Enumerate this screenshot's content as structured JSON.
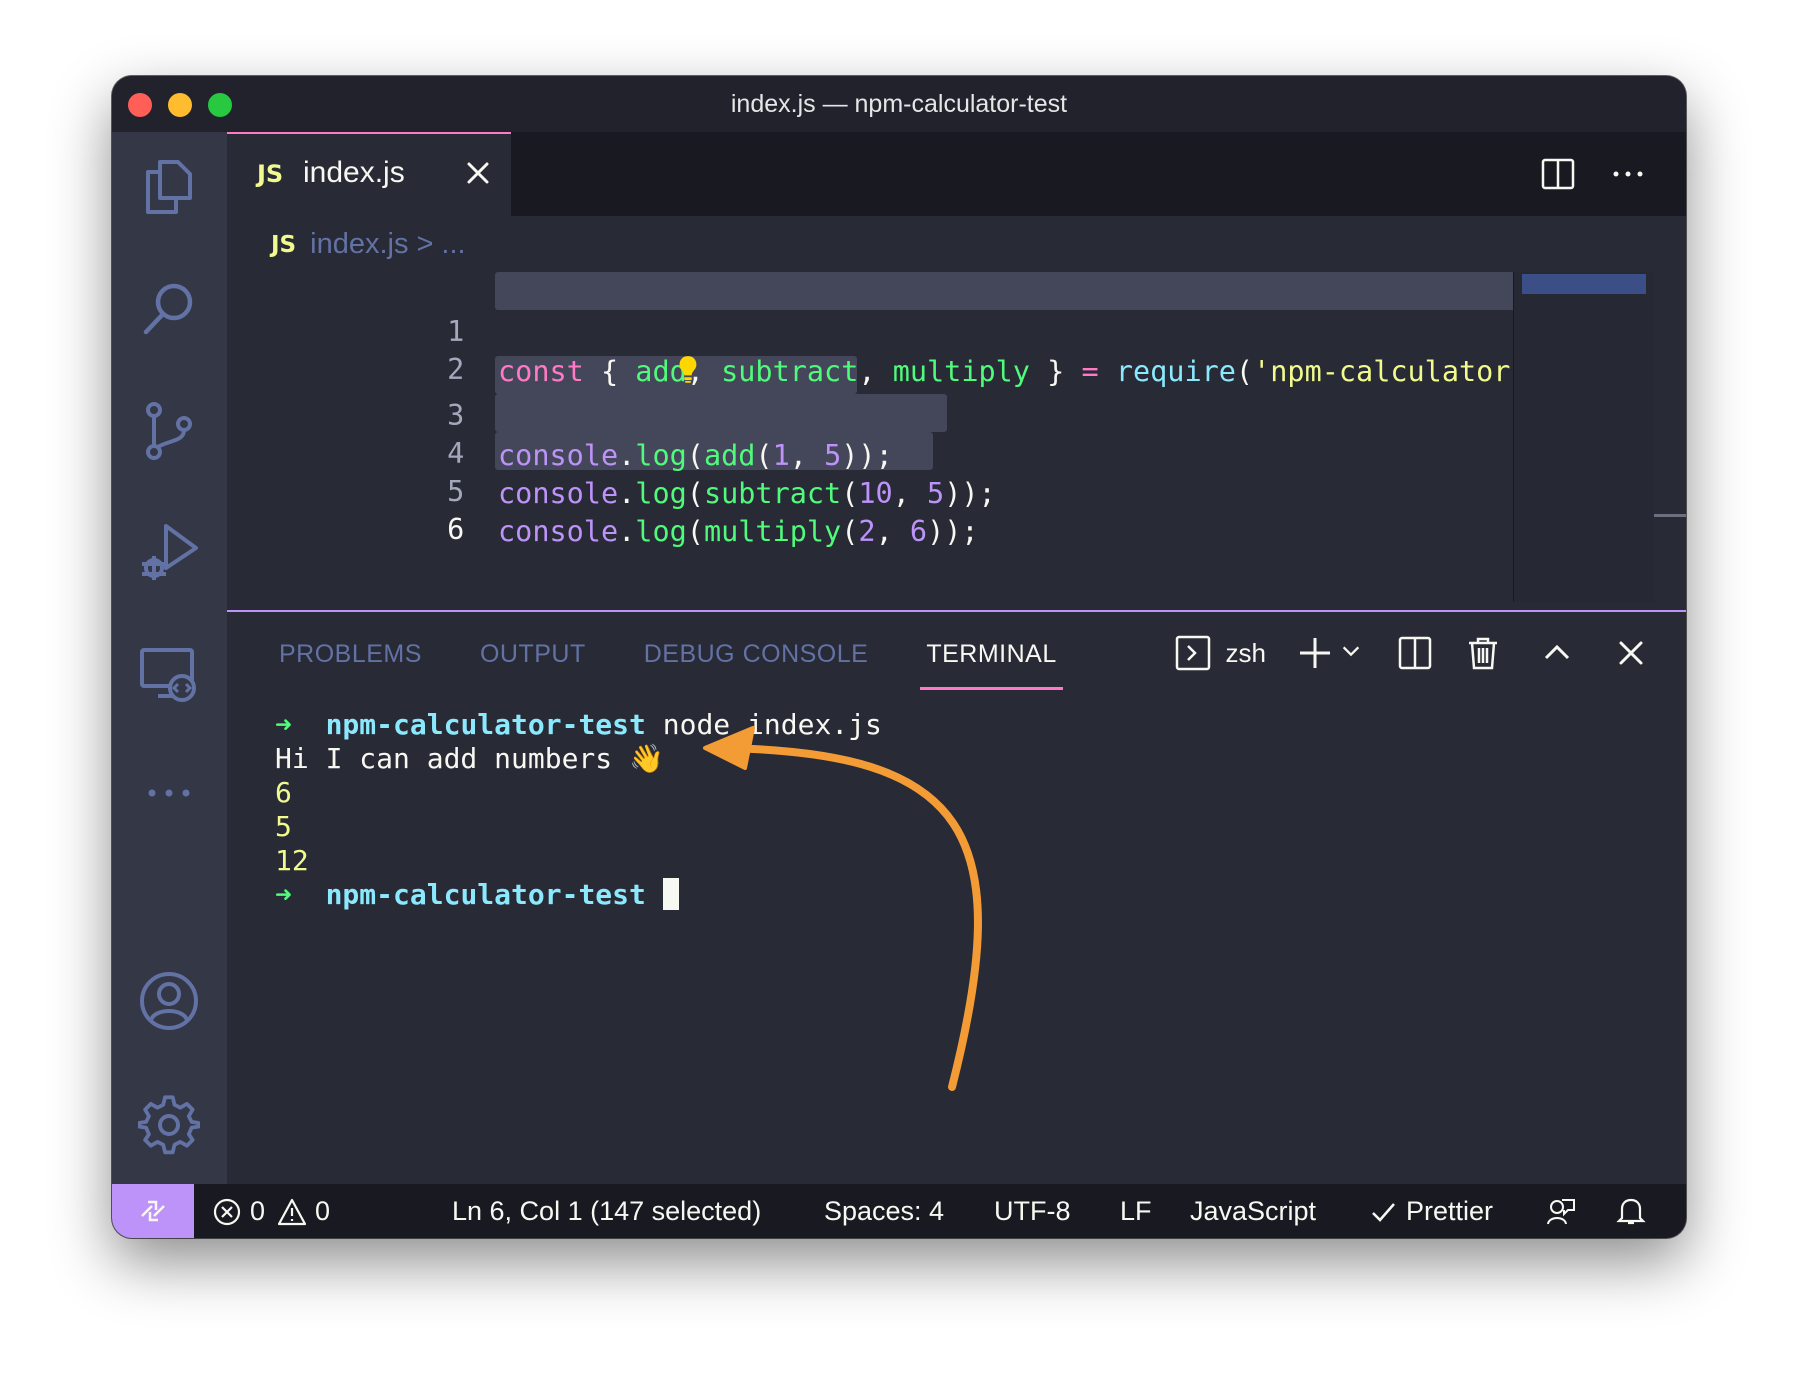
{
  "window": {
    "title": "index.js — npm-calculator-test"
  },
  "tab": {
    "js_badge": "JS",
    "label": "index.js"
  },
  "breadcrumb": {
    "js_badge": "JS",
    "file": "index.js",
    "separator": ">",
    "more": "..."
  },
  "code": {
    "line_numbers": [
      "1",
      "2",
      "3",
      "4",
      "5",
      "6"
    ],
    "line1": {
      "kw": "const",
      "p1": " { ",
      "a": "add",
      "c1": ", ",
      "b": "subtract",
      "c2": ", ",
      "c": "multiply",
      "p2": " } ",
      "eq": "=",
      "sp": " ",
      "req": "require",
      "p3": "(",
      "str": "'npm-calculator'",
      "p4": ");"
    },
    "line3": {
      "obj": "console",
      "dot": ".",
      "m": "log",
      "p1": "(",
      "f": "add",
      "p2": "(",
      "n1": "1",
      "c": ", ",
      "n2": "5",
      "p3": "));"
    },
    "line4": {
      "obj": "console",
      "dot": ".",
      "m": "log",
      "p1": "(",
      "f": "subtract",
      "p2": "(",
      "n1": "10",
      "c": ", ",
      "n2": "5",
      "p3": "));"
    },
    "line5": {
      "obj": "console",
      "dot": ".",
      "m": "log",
      "p1": "(",
      "f": "multiply",
      "p2": "(",
      "n1": "2",
      "c": ", ",
      "n2": "6",
      "p3": "));"
    }
  },
  "panel": {
    "tabs": [
      "PROBLEMS",
      "OUTPUT",
      "DEBUG CONSOLE",
      "TERMINAL"
    ],
    "active_tab": "TERMINAL",
    "shell": "zsh"
  },
  "terminal": {
    "prompt_arrow": "➜",
    "cwd": "npm-calculator-test",
    "command": "node index.js",
    "output": [
      "Hi I can add numbers 👋",
      "6",
      "5",
      "12"
    ]
  },
  "statusbar": {
    "errors": "0",
    "warnings": "0",
    "position": "Ln 6, Col 1 (147 selected)",
    "spaces": "Spaces: 4",
    "encoding": "UTF-8",
    "eol": "LF",
    "language": "JavaScript",
    "formatter": "Prettier"
  },
  "colors": {
    "accent": "#bd93f9",
    "pink": "#ff79c6",
    "green": "#50fa7b",
    "cyan": "#8be9fd",
    "yellow": "#f1fa8c",
    "annotation_arrow": "#f39c35"
  },
  "icons": {
    "activity": [
      "files-icon",
      "search-icon",
      "source-control-icon",
      "run-debug-icon",
      "remote-explorer-icon",
      "more-icon",
      "account-icon",
      "settings-gear-icon"
    ]
  }
}
